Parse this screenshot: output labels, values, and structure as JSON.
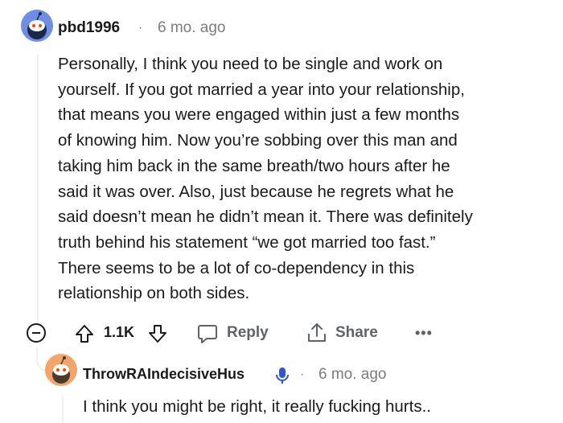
{
  "comment": {
    "username": "pbd1996",
    "separator": "·",
    "time": "6 mo. ago",
    "body_lines": [
      "Personally, I think you need to be single and work on",
      "yourself. If you got married a year into your relationship,",
      "that means you were engaged within just a few months",
      "of knowing him. Now you’re sobbing over this man and",
      "taking him back in the same breath/two hours after he",
      "said it was over. Also, just because he regrets what he",
      "said doesn’t mean he didn’t mean it. There was definitely",
      "truth behind his statement “we got married too fast.”",
      "There seems to be a lot of co-dependency in this",
      "relationship on both sides."
    ],
    "score": "1.1K",
    "reply_label": "Reply",
    "share_label": "Share",
    "more_label": "•••"
  },
  "reply": {
    "username": "ThrowRAIndecisiveHus",
    "separator": "·",
    "time": "6 mo. ago",
    "body": "I think you might be right, it really fucking hurts.."
  },
  "colors": {
    "avatar1": "#6e8ee3",
    "avatar2": "#f2a56b",
    "mod_icon": "#2d55d6",
    "muted": "#7c7c7c"
  }
}
